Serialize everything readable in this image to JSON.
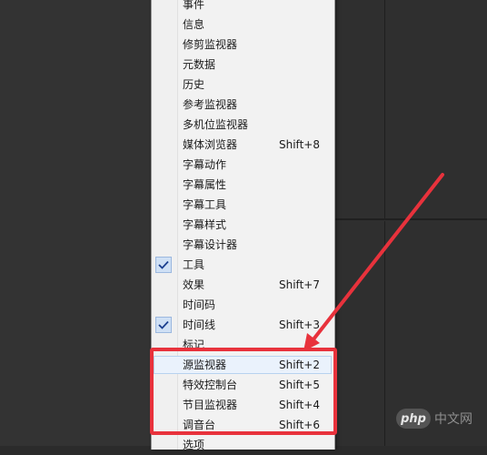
{
  "menu": {
    "items": [
      {
        "label": "事件",
        "shortcut": "",
        "checked": false,
        "hover": false
      },
      {
        "label": "信息",
        "shortcut": "",
        "checked": false,
        "hover": false
      },
      {
        "label": "修剪监视器",
        "shortcut": "",
        "checked": false,
        "hover": false
      },
      {
        "label": "元数据",
        "shortcut": "",
        "checked": false,
        "hover": false
      },
      {
        "label": "历史",
        "shortcut": "",
        "checked": false,
        "hover": false
      },
      {
        "label": "参考监视器",
        "shortcut": "",
        "checked": false,
        "hover": false
      },
      {
        "label": "多机位监视器",
        "shortcut": "",
        "checked": false,
        "hover": false
      },
      {
        "label": "媒体浏览器",
        "shortcut": "Shift+8",
        "checked": false,
        "hover": false
      },
      {
        "label": "字幕动作",
        "shortcut": "",
        "checked": false,
        "hover": false
      },
      {
        "label": "字幕属性",
        "shortcut": "",
        "checked": false,
        "hover": false
      },
      {
        "label": "字幕工具",
        "shortcut": "",
        "checked": false,
        "hover": false
      },
      {
        "label": "字幕样式",
        "shortcut": "",
        "checked": false,
        "hover": false
      },
      {
        "label": "字幕设计器",
        "shortcut": "",
        "checked": false,
        "hover": false
      },
      {
        "label": "工具",
        "shortcut": "",
        "checked": true,
        "hover": false
      },
      {
        "label": "效果",
        "shortcut": "Shift+7",
        "checked": false,
        "hover": false
      },
      {
        "label": "时间码",
        "shortcut": "",
        "checked": false,
        "hover": false
      },
      {
        "label": "时间线",
        "shortcut": "Shift+3",
        "checked": true,
        "hover": false
      },
      {
        "label": "标记",
        "shortcut": "",
        "checked": false,
        "hover": false
      },
      {
        "label": "源监视器",
        "shortcut": "Shift+2",
        "checked": false,
        "hover": true
      },
      {
        "label": "特效控制台",
        "shortcut": "Shift+5",
        "checked": false,
        "hover": false
      },
      {
        "label": "节目监视器",
        "shortcut": "Shift+4",
        "checked": false,
        "hover": false
      },
      {
        "label": "调音台",
        "shortcut": "Shift+6",
        "checked": false,
        "hover": false
      },
      {
        "label": "选项",
        "shortcut": "",
        "checked": false,
        "hover": false
      }
    ]
  },
  "annotation": {
    "box_color": "#e8323c",
    "arrow_color": "#e8323c"
  },
  "watermark": {
    "badge": "php",
    "text": "中文网"
  },
  "icons": {
    "check": "checkmark-icon"
  }
}
